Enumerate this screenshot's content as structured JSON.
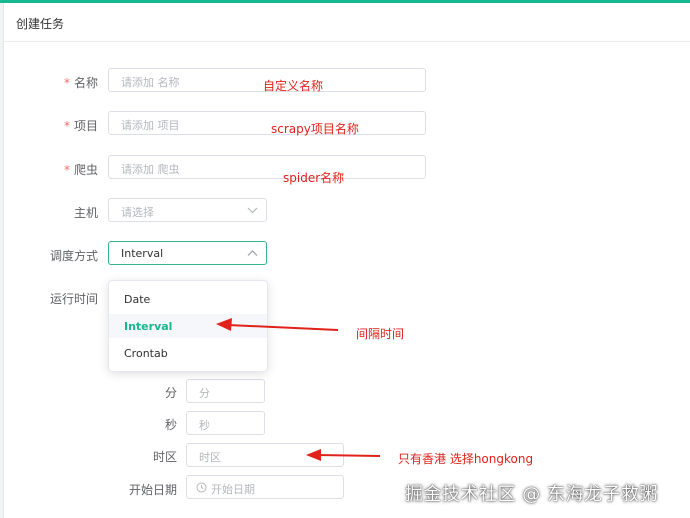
{
  "page": {
    "title": "创建任务"
  },
  "form": {
    "name": {
      "label": "名称",
      "required": true,
      "placeholder": "请添加 名称"
    },
    "project": {
      "label": "项目",
      "required": true,
      "placeholder": "请添加 项目"
    },
    "spider": {
      "label": "爬虫",
      "required": true,
      "placeholder": "请添加 爬虫"
    },
    "host": {
      "label": "主机",
      "placeholder": "请选择"
    },
    "schedule": {
      "label": "调度方式",
      "value": "Interval",
      "options": [
        "Date",
        "Interval",
        "Crontab"
      ],
      "selected": "Interval"
    },
    "run_time": {
      "label": "运行时间"
    },
    "minute": {
      "label": "分",
      "placeholder": "分"
    },
    "second": {
      "label": "秒",
      "placeholder": "秒"
    },
    "timezone": {
      "label": "时区",
      "placeholder": "时区"
    },
    "start_date": {
      "label": "开始日期",
      "placeholder": "开始日期"
    }
  },
  "annotations": {
    "name": "自定义名称",
    "project": "scrapy项目名称",
    "spider": "spider名称",
    "interval": "间隔时间",
    "timezone": "只有香港 选择hongkong"
  },
  "watermark": "掘金技术社区 @ 东海龙子救粥",
  "colors": {
    "accent": "#17b890",
    "required": "#f56c6c",
    "annotation": "#e0221b"
  }
}
